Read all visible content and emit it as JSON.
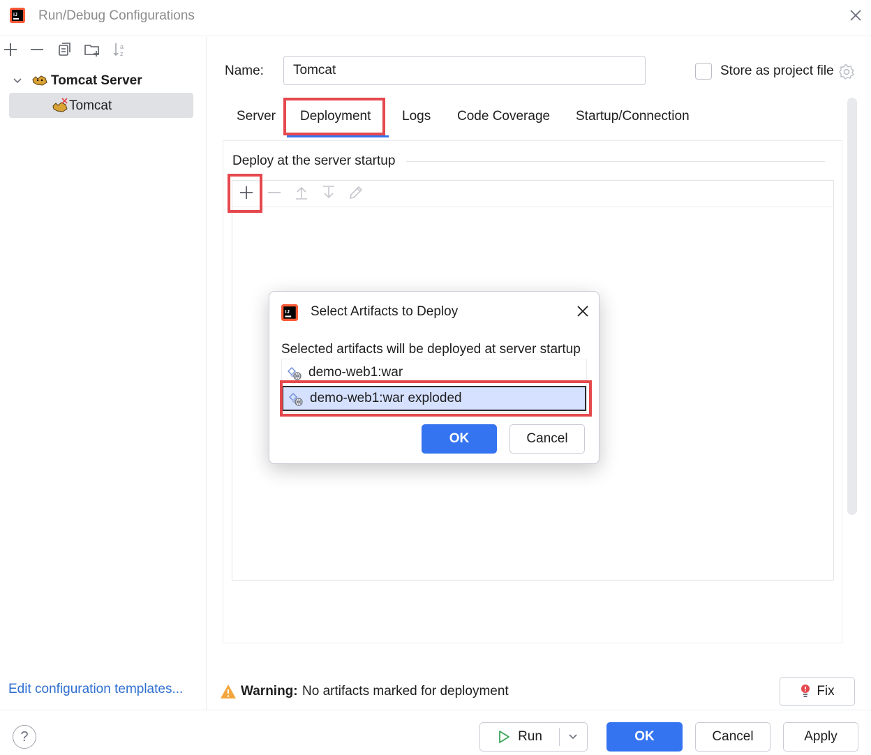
{
  "window": {
    "title": "Run/Debug Configurations"
  },
  "tree": {
    "group_label": "Tomcat Server",
    "item_label": "Tomcat"
  },
  "left_footer": {
    "templates_link": "Edit configuration templates..."
  },
  "form": {
    "name_label": "Name:",
    "name_value": "Tomcat",
    "store_label": "Store as project file"
  },
  "tabs": [
    {
      "label": "Server"
    },
    {
      "label": "Deployment",
      "active": true
    },
    {
      "label": "Logs"
    },
    {
      "label": "Code Coverage"
    },
    {
      "label": "Startup/Connection"
    }
  ],
  "deployment": {
    "section_title": "Deploy at the server startup"
  },
  "dialog": {
    "title": "Select Artifacts to Deploy",
    "description": "Selected artifacts will be deployed at server startup",
    "artifacts": [
      {
        "label": "demo-web1:war",
        "selected": false
      },
      {
        "label": "demo-web1:war exploded",
        "selected": true
      }
    ],
    "ok_label": "OK",
    "cancel_label": "Cancel"
  },
  "warning": {
    "prefix": "Warning:",
    "message": "No artifacts marked for deployment",
    "fix_label": "Fix"
  },
  "footer": {
    "help_label": "?",
    "run_label": "Run",
    "ok_label": "OK",
    "cancel_label": "Cancel",
    "apply_label": "Apply"
  },
  "colors": {
    "accent": "#3574f0",
    "highlight_border": "#e5484d",
    "selection": "#d5e1ff",
    "warning": "#f2a53a"
  }
}
